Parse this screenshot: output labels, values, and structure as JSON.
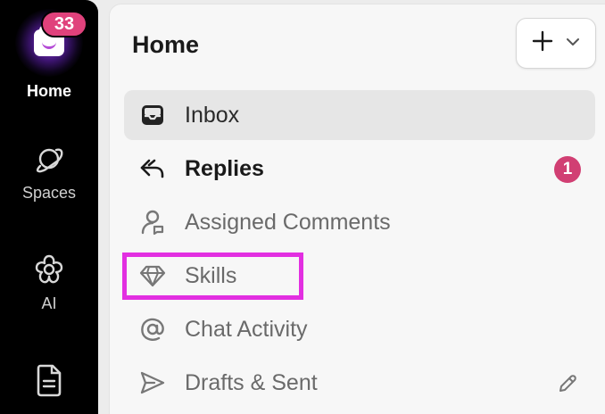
{
  "rail": {
    "home": {
      "label": "Home",
      "badge": "33"
    },
    "spaces": {
      "label": "Spaces"
    },
    "ai": {
      "label": "AI"
    },
    "docs": {
      "label": ""
    }
  },
  "panel": {
    "title": "Home",
    "new_button": {
      "plus_icon": "plus-icon",
      "chevron_icon": "chevron-down-icon"
    },
    "items": [
      {
        "label": "Inbox",
        "icon": "inbox-icon",
        "active": true
      },
      {
        "label": "Replies",
        "icon": "reply-icon",
        "bold": true,
        "badge": "1"
      },
      {
        "label": "Assigned Comments",
        "icon": "assigned-comments-icon"
      },
      {
        "label": "Skills",
        "icon": "diamond-icon"
      },
      {
        "label": "Chat Activity",
        "icon": "at-icon"
      },
      {
        "label": "Drafts & Sent",
        "icon": "send-icon"
      }
    ]
  },
  "colors": {
    "badge": "#d13f73",
    "highlight": "#e22fe1",
    "rail_bg": "#000000"
  }
}
